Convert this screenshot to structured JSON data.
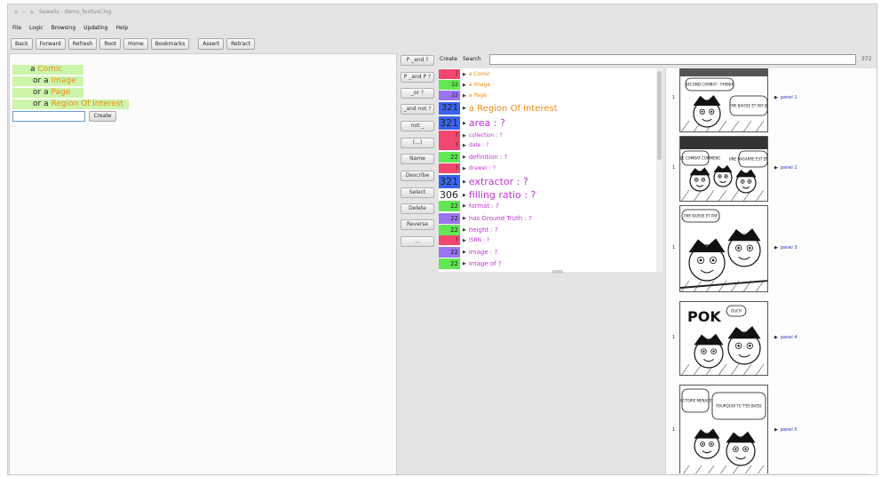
{
  "window": {
    "title": "Sewelis - demo_festival.log",
    "controls": [
      "×",
      "−",
      "+"
    ]
  },
  "menu": [
    "File",
    "Logic",
    "Browsing",
    "Updating",
    "Help"
  ],
  "toolbar": {
    "back": "Back",
    "forward": "Forward",
    "refresh": "Refresh",
    "root": "Root",
    "home": "Home",
    "bookmarks": "Bookmarks",
    "assert": "Assert",
    "retract": "Retract"
  },
  "query": {
    "rows": [
      {
        "prefix": "a",
        "name": "Comic"
      },
      {
        "prefix": "or a",
        "name": "Image"
      },
      {
        "prefix": "or a",
        "name": "Page"
      },
      {
        "prefix": "or a",
        "name": "Region Of Interest"
      }
    ],
    "create_value": "",
    "create_label": "Create"
  },
  "operators": [
    "P _and ?",
    "P _and P ?",
    "_or ?",
    "_and not ?",
    "not _",
    "(...)",
    "Name",
    "Describe",
    "Select",
    "Delete",
    "Reverse",
    "..."
  ],
  "search": {
    "create_label": "Create",
    "search_label": "Search",
    "value": "",
    "count": "372"
  },
  "properties": [
    {
      "count": "7",
      "label": "a Comic",
      "color": "#f2476f",
      "text_color": "#f08c13"
    },
    {
      "count": "22",
      "label": "a Image",
      "color": "#61e654",
      "text_color": "#f08c13"
    },
    {
      "count": "22",
      "label": "a Page",
      "color": "#9a75f2",
      "text_color": "#f08c13"
    },
    {
      "count": "321",
      "label": "a Region Of Interest",
      "color": "#3b63f0",
      "text_color": "#f08c13"
    },
    {
      "count": "321",
      "label": "area : ?",
      "color": "#3b63f0",
      "text_color": "#c232d6"
    },
    {
      "count": "7",
      "label": "collection : ?",
      "color": "#f2476f",
      "text_color": "#c232d6"
    },
    {
      "count": "7",
      "label": "date : ?",
      "color": "#f2476f",
      "text_color": "#c232d6"
    },
    {
      "count": "22",
      "label": "definition : ?",
      "color": "#61e654",
      "text_color": "#c232d6"
    },
    {
      "count": "7",
      "label": "drawer : ?",
      "color": "#f2476f",
      "text_color": "#c232d6"
    },
    {
      "count": "321",
      "label": "extractor : ?",
      "color": "#3b63f0",
      "text_color": "#c232d6"
    },
    {
      "count": "306",
      "label": "filling ratio : ?",
      "color": "#ffffff",
      "text_color": "#c232d6"
    },
    {
      "count": "22",
      "label": "format : ?",
      "color": "#61e654",
      "text_color": "#c232d6"
    },
    {
      "count": "22",
      "label": "has Ground Truth : ?",
      "color": "#9a75f2",
      "text_color": "#c232d6"
    },
    {
      "count": "22",
      "label": "height : ?",
      "color": "#61e654",
      "text_color": "#c232d6"
    },
    {
      "count": "7",
      "label": "ISBN : ?",
      "color": "#f2476f",
      "text_color": "#c232d6"
    },
    {
      "count": "22",
      "label": "image : ?",
      "color": "#9a75f2",
      "text_color": "#c232d6"
    },
    {
      "count": "22",
      "label": "image of ?",
      "color": "#61e654",
      "text_color": "#c232d6"
    }
  ],
  "panels": [
    {
      "num": "1",
      "label": "panel 1",
      "caption": "SECOND COMBAT : PHENIX CONTRE SHAPE",
      "bubble": "J'ME BAISSE ET PAF JE LUI POQUE LE MENTON"
    },
    {
      "num": "1",
      "label": "panel 2",
      "caption": "VOIR LE COMBAT COMMENCE",
      "bubble": "UNE BAGARRE EST EN COURS"
    },
    {
      "num": "1",
      "label": "panel 3",
      "caption": "J'ME BAISSE ET PAF",
      "bubble": ""
    },
    {
      "num": "1",
      "label": "panel 4",
      "caption": "POK",
      "bubble": "OUCH"
    },
    {
      "num": "1",
      "label": "panel 5",
      "caption": "VICTOIRE MENACE",
      "bubble": "POURQUOI TU T'ES BAISSÉ ? J'COMPTAIS TE FAIRE CONFIANCE"
    }
  ]
}
